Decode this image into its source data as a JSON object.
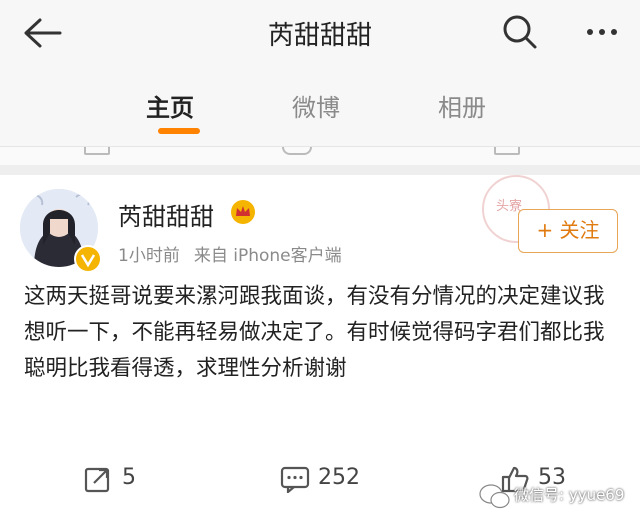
{
  "header": {
    "title": "芮甜甜甜"
  },
  "tabs": [
    {
      "label": "主页"
    },
    {
      "label": "微博"
    },
    {
      "label": "相册"
    }
  ],
  "post": {
    "username": "芮甜甜甜",
    "time": "1小时前",
    "source": "来自 iPhone客户端",
    "follow_label": "+ 关注",
    "stamp_text": "头寮",
    "content": "这两天挺哥说要来漯河跟我面谈，有没有分情况的决定建议我想听一下，不能再轻易做决定了。有时候觉得码字君们都比我聪明比我看得透，求理性分析谢谢",
    "forward_count": "5",
    "comment_count": "252",
    "like_count": "53"
  },
  "watermark": {
    "text": "微信号: yyue69"
  },
  "colors": {
    "accent": "#ff8200",
    "follow_border": "#e8a657",
    "follow_text": "#e07b10"
  },
  "icons": [
    "back-arrow-icon",
    "search-icon",
    "more-icon",
    "crown-icon",
    "forward-icon",
    "comment-icon",
    "like-icon",
    "wechat-icon"
  ]
}
